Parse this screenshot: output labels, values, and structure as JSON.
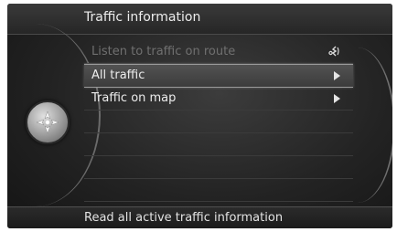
{
  "header": {
    "title": "Traffic information"
  },
  "menu": {
    "items": [
      {
        "label": "Listen to traffic on route",
        "state": "disabled",
        "icon": "voice-command-icon"
      },
      {
        "label": "All traffic",
        "state": "selected",
        "icon": "submenu-arrow-icon"
      },
      {
        "label": "Traffic on map",
        "state": "normal",
        "icon": "submenu-arrow-icon"
      }
    ],
    "empty_rows": 4
  },
  "nav_control": {
    "icon": "navigation-knob-icon"
  },
  "footer": {
    "help_text": "Read all active traffic information"
  },
  "colors": {
    "background": "#232323",
    "text": "#ececec",
    "disabled_text": "#707070",
    "selection": "#4a4a4a"
  }
}
